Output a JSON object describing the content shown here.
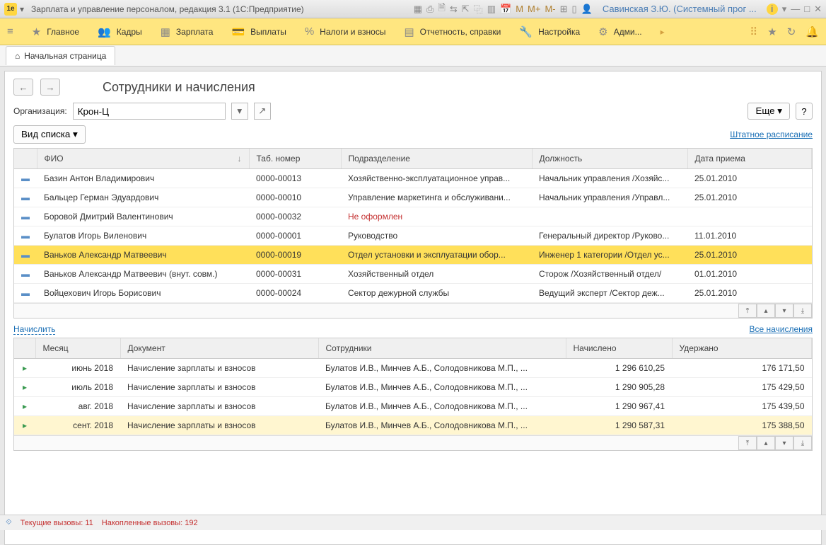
{
  "titlebar": {
    "title": "Зарплата и управление персоналом, редакция 3.1  (1С:Предприятие)",
    "user": "Савинская З.Ю. (Системный прог ...",
    "m": "M",
    "mplus": "M+",
    "mminus": "M-"
  },
  "menu": {
    "main": "Главное",
    "kadry": "Кадры",
    "zarplata": "Зарплата",
    "vyplaty": "Выплаты",
    "nalogi": "Налоги и взносы",
    "otchet": "Отчетность, справки",
    "nastroyka": "Настройка",
    "admin": "Адми..."
  },
  "tab": {
    "home": "Начальная страница"
  },
  "page": {
    "title": "Сотрудники и начисления",
    "org_label": "Организация:",
    "org_value": "Крон-Ц",
    "more": "Еще",
    "help": "?",
    "list_view": "Вид списка",
    "shtatnoe": "Штатное расписание",
    "nachislit": "Начислить",
    "vse_nach": "Все начисления"
  },
  "grid1": {
    "headers": {
      "fio": "ФИО",
      "tab": "Таб. номер",
      "podr": "Подразделение",
      "dolzh": "Должность",
      "data": "Дата приема"
    },
    "rows": [
      {
        "fio": "Базин Антон Владимирович",
        "tab": "0000-00013",
        "podr": "Хозяйственно-эксплуатационное управ...",
        "dolzh": "Начальник управления /Хозяйс...",
        "data": "25.01.2010"
      },
      {
        "fio": "Бальцер Герман Эдуардович",
        "tab": "0000-00010",
        "podr": "Управление маркетинга и обслуживани...",
        "dolzh": "Начальник управления /Управл...",
        "data": "25.01.2010"
      },
      {
        "fio": "Боровой Дмитрий Валентинович",
        "tab": "0000-00032",
        "podr": "Не оформлен",
        "dolzh": "",
        "data": "",
        "red": true
      },
      {
        "fio": "Булатов Игорь Виленович",
        "tab": "0000-00001",
        "podr": "Руководство",
        "dolzh": "Генеральный директор /Руково...",
        "data": "11.01.2010"
      },
      {
        "fio": "Ваньков Александр Матвеевич",
        "tab": "0000-00019",
        "podr": "Отдел установки и эксплуатации обор...",
        "dolzh": "Инженер 1 категории /Отдел ус...",
        "data": "25.01.2010",
        "sel": true
      },
      {
        "fio": "Ваньков Александр Матвеевич (внут. совм.)",
        "tab": "0000-00031",
        "podr": "Хозяйственный отдел",
        "dolzh": "Сторож /Хозяйственный отдел/",
        "data": "01.01.2010"
      },
      {
        "fio": "Войцехович Игорь Борисович",
        "tab": "0000-00024",
        "podr": "Сектор дежурной службы",
        "dolzh": "Ведущий эксперт /Сектор деж...",
        "data": "25.01.2010"
      }
    ]
  },
  "grid2": {
    "headers": {
      "mes": "Месяц",
      "doc": "Документ",
      "sotr": "Сотрудники",
      "nach": "Начислено",
      "ud": "Удержано"
    },
    "rows": [
      {
        "mes": "июнь 2018",
        "doc": "Начисление зарплаты и взносов",
        "sotr": "Булатов И.В., Минчев А.Б., Солодовникова М.П., ...",
        "nach": "1 296 610,25",
        "ud": "176 171,50"
      },
      {
        "mes": "июль 2018",
        "doc": "Начисление зарплаты и взносов",
        "sotr": "Булатов И.В., Минчев А.Б., Солодовникова М.П., ...",
        "nach": "1 290 905,28",
        "ud": "175 429,50"
      },
      {
        "mes": "авг. 2018",
        "doc": "Начисление зарплаты и взносов",
        "sotr": "Булатов И.В., Минчев А.Б., Солодовникова М.П., ...",
        "nach": "1 290 967,41",
        "ud": "175 439,50"
      },
      {
        "mes": "сент. 2018",
        "doc": "Начисление зарплаты и взносов",
        "sotr": "Булатов И.В., Минчев А.Б., Солодовникова М.П., ...",
        "nach": "1 290 587,31",
        "ud": "175 388,50",
        "sel": true
      }
    ]
  },
  "status": {
    "s1": "Текущие вызовы: 11",
    "s2": "Накопленные вызовы: 192"
  }
}
